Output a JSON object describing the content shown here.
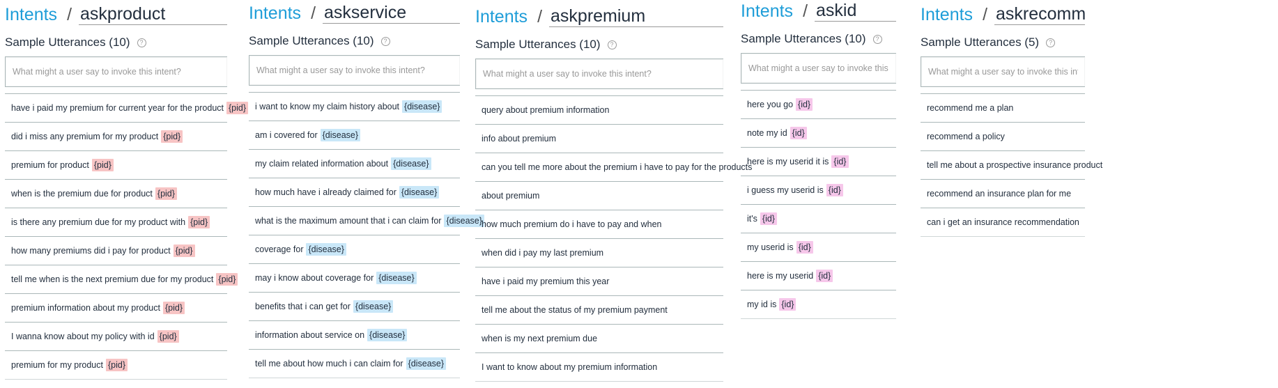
{
  "common": {
    "intents_label": "Intents",
    "sample_utterances_prefix": "Sample Utterances",
    "placeholder": "What might a user say to invoke this intent?",
    "help_glyph": "?"
  },
  "colors": {
    "link": "#1e9dd8",
    "slot_pid": "#f7c4c4",
    "slot_disease": "#c9e7f8",
    "slot_id": "#f6c7ea"
  },
  "panels": [
    {
      "intent_name": "askproduct",
      "count_label": "Sample Utterances (10)",
      "slot_kind": "pid",
      "utterances": [
        {
          "text": "have i paid my premium for current year for the product",
          "slot": "{pid}"
        },
        {
          "text": "did i miss any premium for my product",
          "slot": "{pid}"
        },
        {
          "text": "premium for product",
          "slot": "{pid}"
        },
        {
          "text": "when is the premium due for product",
          "slot": "{pid}"
        },
        {
          "text": "is there any premium due for my product with",
          "slot": "{pid}"
        },
        {
          "text": "how many premiums did i pay for product",
          "slot": "{pid}"
        },
        {
          "text": "tell me when is the next premium due for my product",
          "slot": "{pid}"
        },
        {
          "text": "premium information about my product",
          "slot": "{pid}"
        },
        {
          "text": "I wanna know about my policy with id",
          "slot": "{pid}"
        },
        {
          "text": "premium for my product",
          "slot": "{pid}"
        }
      ]
    },
    {
      "intent_name": "askservice",
      "count_label": "Sample Utterances (10)",
      "slot_kind": "disease",
      "utterances": [
        {
          "text": "i want to know my claim history about",
          "slot": "{disease}"
        },
        {
          "text": "am i covered for",
          "slot": "{disease}"
        },
        {
          "text": "my claim related information about",
          "slot": "{disease}"
        },
        {
          "text": "how much have i already claimed for",
          "slot": "{disease}"
        },
        {
          "text": "what is the maximum amount that i can claim for",
          "slot": "{disease}"
        },
        {
          "text": "coverage for",
          "slot": "{disease}"
        },
        {
          "text": "may i know about coverage for",
          "slot": "{disease}"
        },
        {
          "text": "benefits that i can get for",
          "slot": "{disease}"
        },
        {
          "text": "information about service on",
          "slot": "{disease}"
        },
        {
          "text": "tell me about how much i can claim for",
          "slot": "{disease}"
        }
      ]
    },
    {
      "intent_name": "askpremium",
      "count_label": "Sample Utterances (10)",
      "slot_kind": "none",
      "utterances": [
        {
          "text": "query about premium information",
          "slot": ""
        },
        {
          "text": "info about premium",
          "slot": ""
        },
        {
          "text": "can you tell me more about the premium i have to pay for the products",
          "slot": ""
        },
        {
          "text": "about premium",
          "slot": ""
        },
        {
          "text": "how much premium do i have to pay and when",
          "slot": ""
        },
        {
          "text": "when did i pay my last premium",
          "slot": ""
        },
        {
          "text": "have i paid my premium this year",
          "slot": ""
        },
        {
          "text": "tell me about the status of my premium payment",
          "slot": ""
        },
        {
          "text": "when is my next premium due",
          "slot": ""
        },
        {
          "text": "I want to know about my premium information",
          "slot": ""
        }
      ]
    },
    {
      "intent_name": "askid",
      "count_label": "Sample Utterances (10)",
      "slot_kind": "id",
      "utterances": [
        {
          "text": "here you go",
          "slot": "{id}"
        },
        {
          "text": "note my id",
          "slot": "{id}"
        },
        {
          "text": "here is my userid it is",
          "slot": "{id}"
        },
        {
          "text": "i guess my userid is",
          "slot": "{id}"
        },
        {
          "text": "it's",
          "slot": "{id}"
        },
        {
          "text": "my userid is",
          "slot": "{id}"
        },
        {
          "text": "here is my userid",
          "slot": "{id}"
        },
        {
          "text": "my id is",
          "slot": "{id}"
        }
      ]
    },
    {
      "intent_name": "askrecommend",
      "count_label": "Sample Utterances (5)",
      "slot_kind": "none",
      "utterances": [
        {
          "text": "recommend me a plan",
          "slot": ""
        },
        {
          "text": "recommend a policy",
          "slot": ""
        },
        {
          "text": "tell me about a prospective insurance product",
          "slot": ""
        },
        {
          "text": "recommend an insurance plan for me",
          "slot": ""
        },
        {
          "text": "can i get an insurance recommendation",
          "slot": ""
        }
      ]
    }
  ]
}
